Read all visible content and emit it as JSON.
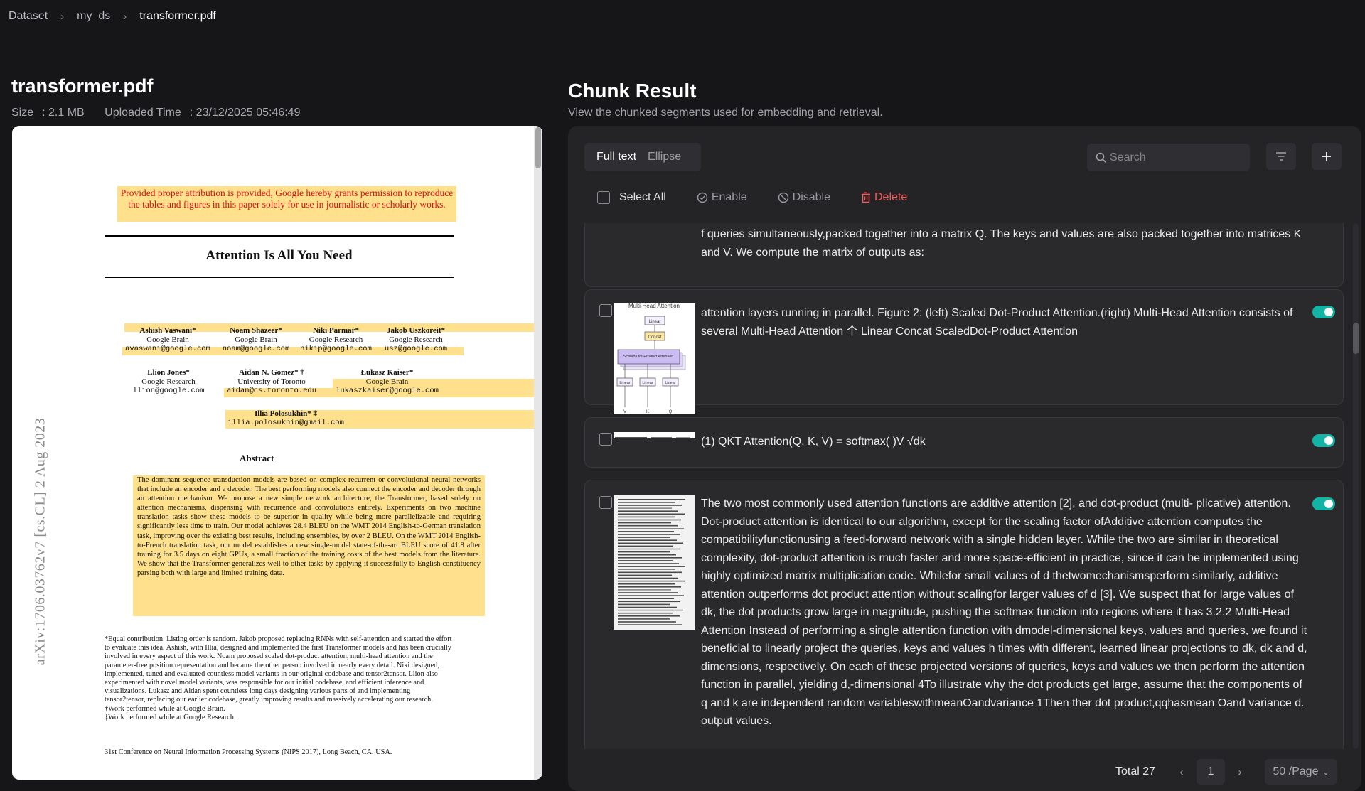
{
  "breadcrumb": [
    "Dataset",
    "my_ds",
    "transformer.pdf"
  ],
  "document": {
    "title": "transformer.pdf",
    "size_label": "Size",
    "size": "2.1 MB",
    "uploaded_label": "Uploaded Time",
    "uploaded": "23/12/2025 05:46:49"
  },
  "pdf": {
    "permission": "Provided proper attribution is provided, Google hereby grants permission to reproduce the tables and figures in this paper solely for use in journalistic or scholarly works.",
    "title": "Attention Is All You Need",
    "arxiv": "arXiv:1706.03762v7  [cs.CL]  2 Aug 2023",
    "authors": [
      {
        "name": "Ashish Vaswani*",
        "org": "Google Brain",
        "email": "avaswani@google.com"
      },
      {
        "name": "Noam Shazeer*",
        "org": "Google Brain",
        "email": "noam@google.com"
      },
      {
        "name": "Niki Parmar*",
        "org": "Google Research",
        "email": "nikip@google.com"
      },
      {
        "name": "Jakob Uszkoreit*",
        "org": "Google Research",
        "email": "usz@google.com"
      },
      {
        "name": "Llion Jones*",
        "org": "Google Research",
        "email": "llion@google.com"
      },
      {
        "name": "Aidan N. Gomez* †",
        "org": "University of Toronto",
        "email": "aidan@cs.toronto.edu"
      },
      {
        "name": "Łukasz Kaiser*",
        "org": "Google Brain",
        "email": "lukaszkaiser@google.com"
      },
      {
        "name": "Illia Polosukhin* ‡",
        "org": "",
        "email": "illia.polosukhin@gmail.com"
      }
    ],
    "abstract_title": "Abstract",
    "abstract": "The dominant sequence transduction models are based on complex recurrent or convolutional neural networks that include an encoder and a decoder. The best performing models also connect the encoder and decoder through an attention mechanism. We propose a new simple network architecture, the Transformer, based solely on attention mechanisms, dispensing with recurrence and convolutions entirely. Experiments on two machine translation tasks show these models to be superior in quality while being more parallelizable and requiring significantly less time to train. Our model achieves 28.4 BLEU on the WMT 2014 English-to-German translation task, improving over the existing best results, including ensembles, by over 2 BLEU. On the WMT 2014 English-to-French translation task, our model establishes a new single-model state-of-the-art BLEU score of 41.8 after training for 3.5 days on eight GPUs, a small fraction of the training costs of the best models from the literature. We show that the Transformer generalizes well to other tasks by applying it successfully to English constituency parsing both with large and limited training data.",
    "footnote": "*Equal contribution. Listing order is random. Jakob proposed replacing RNNs with self-attention and started the effort to evaluate this idea. Ashish, with Illia, designed and implemented the first Transformer models and has been crucially involved in every aspect of this work. Noam proposed scaled dot-product attention, multi-head attention and the parameter-free position representation and became the other person involved in nearly every detail. Niki designed, implemented, tuned and evaluated countless model variants in our original codebase and tensor2tensor. Llion also experimented with novel model variants, was responsible for our initial codebase, and efficient inference and visualizations. Lukasz and Aidan spent countless long days designing various parts of and implementing tensor2tensor, replacing our earlier codebase, greatly improving results and massively accelerating our research.",
    "footnote_dagger": "†Work performed while at Google Brain.",
    "footnote_ddagger": "‡Work performed while at Google Research.",
    "venue": "31st Conference on Neural Information Processing Systems (NIPS 2017), Long Beach, CA, USA."
  },
  "chunks_panel": {
    "title": "Chunk Result",
    "subtitle": "View the chunked segments used for embedding and retrieval.",
    "view_modes": [
      "Full text",
      "Ellipse"
    ],
    "search_placeholder": "Search",
    "actions": {
      "select_all": "Select All",
      "enable": "Enable",
      "disable": "Disable",
      "delete": "Delete"
    },
    "chunks": [
      {
        "text": "f queries simultaneously,packed together into a matrix Q. The keys and values are also packed together into matrices K and V. We compute the matrix of outputs as:",
        "has_image": false,
        "enabled": null
      },
      {
        "text": "attention layers running in parallel. Figure 2: (left) Scaled Dot-Product Attention.(right) Multi-Head Attention consists of several Multi-Head Attention 个 Linear Concat ScaledDot-Product Attention",
        "has_image": true,
        "enabled": true
      },
      {
        "text": "(1) QKT Attention(Q, K, V) = softmax( )V √dk",
        "has_image": true,
        "enabled": true
      },
      {
        "text": "The two most commonly used attention functions are additive attention [2], and dot-product (multi- plicative) attention. Dot-product attention is identical to our algorithm, except for the scaling factor ofAdditive attention computes the compatibilityfunctionusing a feed-forward network with a single hidden layer. While the two are similar in theoretical complexity, dot-product attention is much faster and more space-efficient in practice, since it can be implemented using highly optimized matrix multiplication code. Whilefor small values of d thetwomechanismsperform similarly, additive attention outperforms dot product attention without scalingfor larger values of d [3]. We suspect that for large values of dk, the dot products grow large in magnitude, pushing the softmax function into regions where it has 3.2.2 Multi-Head Attention Instead of performing a single attention function with dmodel-dimensional keys, values and queries, we found it beneficial to linearly project the queries, keys and values h times with different, learned linear projections to dk, dk and d, dimensions, respectively. On each of these projected versions of queries, keys and values we then perform the attention function in parallel, yielding d,-dimensional 4To illustrate why the dot products get large, assume that the components of q and k are independent random variableswithmeanOandvariance 1Then ther dot product,qqhasmean Oand variance d. output values.",
        "has_image": true,
        "enabled": true
      }
    ],
    "figure": {
      "caption": "Multi-Head Attention",
      "linear": "Linear",
      "concat": "Concat",
      "sdpa": "Scaled Dot-Product Attention",
      "inputs": [
        "V",
        "K",
        "Q"
      ]
    },
    "pagination": {
      "total_label": "Total",
      "total": 27,
      "page": "1",
      "page_size": "50 /Page"
    }
  },
  "colors": {
    "accent": "#13b3a6",
    "danger": "#f05b5b",
    "highlight": "#ffe08c"
  }
}
